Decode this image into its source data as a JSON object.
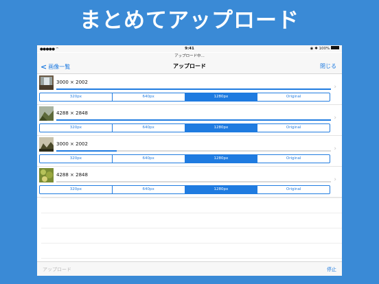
{
  "headline": "まとめてアップロード",
  "status_bar": {
    "carrier": "●●●●● ",
    "time": "9:41",
    "battery": "100%"
  },
  "prompt": "アップロード中...",
  "nav": {
    "back_label": "画像一覧",
    "title": "アップロード",
    "close_label": "閉じる"
  },
  "size_options": [
    "320px",
    "640px",
    "1280px",
    "Original"
  ],
  "items": [
    {
      "dims": "3000 × 2002",
      "progress": 1.0,
      "selected": "1280px"
    },
    {
      "dims": "4288 × 2848",
      "progress": 1.0,
      "selected": "1280px"
    },
    {
      "dims": "3000 × 2002",
      "progress": 0.22,
      "selected": "1280px"
    },
    {
      "dims": "4288 × 2848",
      "progress": 0.0,
      "selected": "1280px"
    }
  ],
  "toolbar": {
    "upload_label": "アップロード",
    "stop_label": "停止"
  },
  "colors": {
    "background": "#3a8ad6",
    "accent": "#1f7be0"
  }
}
